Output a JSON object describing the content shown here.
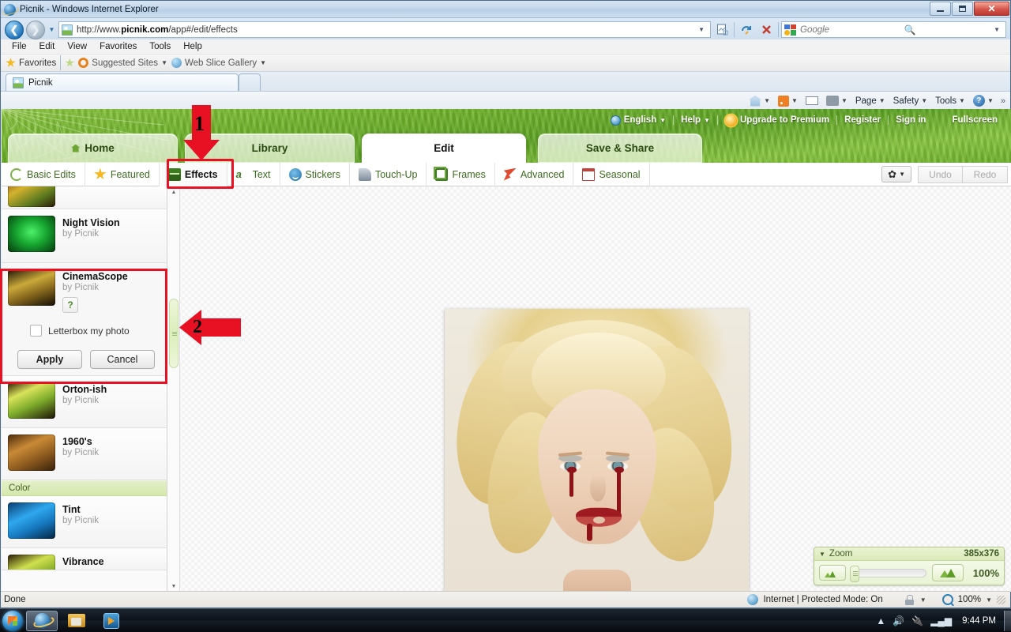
{
  "window": {
    "title": "Picnik - Windows Internet Explorer",
    "controls": {
      "minimize": "—",
      "maximize": "❐",
      "close": "✕"
    }
  },
  "browser": {
    "url_plain_1": "http://www.",
    "url_strong": "picnik.com",
    "url_plain_2": "/app#/edit/effects",
    "search_placeholder": "Google",
    "menu": [
      "File",
      "Edit",
      "View",
      "Favorites",
      "Tools",
      "Help"
    ],
    "favorites_bar": {
      "favorites_label": "Favorites",
      "suggested_sites": "Suggested Sites",
      "web_slice_gallery": "Web Slice Gallery"
    },
    "tab_title": "Picnik",
    "command_bar": [
      "Page",
      "Safety",
      "Tools"
    ],
    "overflow": "»",
    "status": {
      "left": "Done",
      "zone": "Internet | Protected Mode: On",
      "zoom": "100%"
    }
  },
  "picnik": {
    "top_links": {
      "language": "English",
      "help": "Help",
      "upgrade": "Upgrade to Premium",
      "register": "Register",
      "signin": "Sign in",
      "fullscreen": "Fullscreen"
    },
    "main_tabs": [
      {
        "label": "Home",
        "active": false
      },
      {
        "label": "Library",
        "active": false
      },
      {
        "label": "Edit",
        "active": true
      },
      {
        "label": "Save & Share",
        "active": false
      }
    ],
    "sub_tabs": [
      {
        "label": "Basic Edits",
        "icon": "refresh-circle-icon",
        "active": false
      },
      {
        "label": "Featured",
        "icon": "star-icon",
        "active": false
      },
      {
        "label": "Effects",
        "icon": "effects-book-icon",
        "active": true
      },
      {
        "label": "Text",
        "icon": "abc-text-icon",
        "active": false
      },
      {
        "label": "Stickers",
        "icon": "smiley-icon",
        "active": false
      },
      {
        "label": "Touch-Up",
        "icon": "lipstick-icon",
        "active": false
      },
      {
        "label": "Frames",
        "icon": "frames-icon",
        "active": false
      },
      {
        "label": "Advanced",
        "icon": "rocket-icon",
        "active": false
      },
      {
        "label": "Seasonal",
        "icon": "calendar-icon",
        "active": false
      }
    ],
    "toolbar_right": {
      "gear": "gear-icon",
      "undo": "Undo",
      "redo": "Redo"
    },
    "effects_list": [
      {
        "name": "",
        "by": "",
        "partial": true
      },
      {
        "name": "Night Vision",
        "by": "by Picnik"
      },
      {
        "name": "CinemaScope",
        "by": "by Picnik",
        "selected": true,
        "help_badge": "?",
        "checkbox_label": "Letterbox my photo",
        "checkbox_checked": false,
        "apply_label": "Apply",
        "cancel_label": "Cancel"
      },
      {
        "name": "Orton-ish",
        "by": "by Picnik"
      },
      {
        "name": "1960's",
        "by": "by Picnik"
      },
      {
        "category": "Color"
      },
      {
        "name": "Tint",
        "by": "by Picnik"
      },
      {
        "name": "Vibrance",
        "by": "",
        "partial": true
      }
    ],
    "zoom_panel": {
      "label": "Zoom",
      "dimensions": "385x376",
      "percent": "100%",
      "zoom_out_icon": "mountain-small-icon",
      "zoom_in_icon": "mountain-large-icon"
    }
  },
  "annotations": [
    {
      "number": "1",
      "target": "effects-tab"
    },
    {
      "number": "2",
      "target": "sidebar-scrollbar-thumb"
    }
  ],
  "taskbar": {
    "clock": "9:44 PM",
    "apps": [
      "internet-explorer",
      "windows-explorer",
      "windows-media-player"
    ]
  },
  "colors": {
    "accent_green": "#6fb32c",
    "annotation_red": "#e81123",
    "grass_header": "#74b82e",
    "category_band": "#d5e8ae"
  }
}
